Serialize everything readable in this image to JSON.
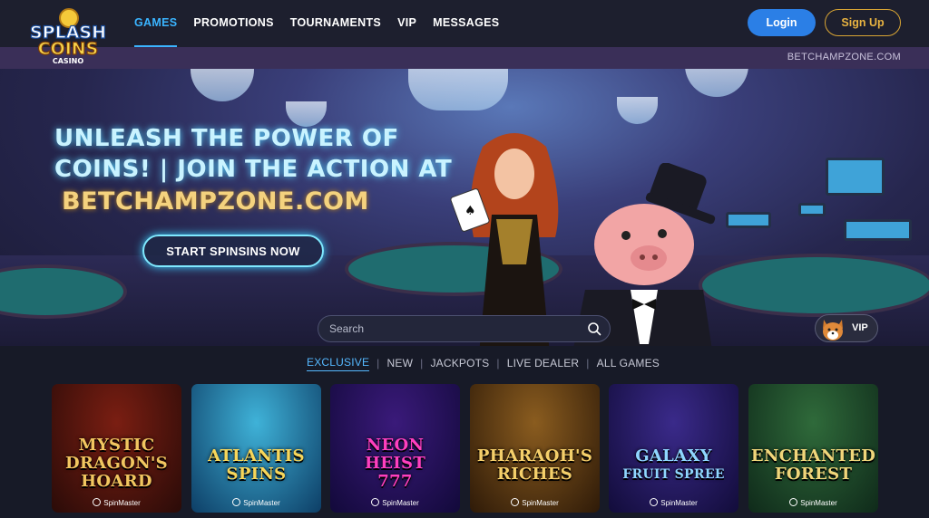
{
  "brand": {
    "logo_line1": "SPLASH",
    "logo_line2": "COINS",
    "logo_line3": "CASINO"
  },
  "nav": {
    "items": [
      "GAMES",
      "PROMOTIONS",
      "TOURNAMENTS",
      "VIP",
      "MESSAGES"
    ],
    "active": "GAMES"
  },
  "auth": {
    "login": "Login",
    "signup": "Sign Up"
  },
  "subbar": {
    "domain": "BETCHAMPZONE.COM"
  },
  "hero": {
    "line1": "UNLEASH THE POWER OF",
    "line2": "COINS! | JOIN THE ACTION AT",
    "line3": "BETCHAMPZONE.COM",
    "cta": "START SPINSINS NOW"
  },
  "search": {
    "placeholder": "Search"
  },
  "vip": {
    "label": "VIP"
  },
  "tabs": {
    "items": [
      "EXCLUSIVE",
      "NEW",
      "JACKPOTS",
      "LIVE DEALER",
      "ALL GAMES"
    ],
    "active": "EXCLUSIVE"
  },
  "games": [
    {
      "title_l1": "MYSTIC",
      "title_l2": "DRAGON'S",
      "title_l3": "HOARD",
      "provider": "SpinMaster",
      "bg1": "#7a1e12",
      "bg2": "#2a0b08",
      "text": "#f2c660"
    },
    {
      "title_l1": "",
      "title_l2": "ATLANTIS",
      "title_l3": "SPINS",
      "provider": "SpinMaster",
      "bg1": "#3fb2d8",
      "bg2": "#0d3e66",
      "text": "#f7d65a"
    },
    {
      "title_l1": "NEON",
      "title_l2": "HEIST",
      "title_l3": "777",
      "provider": "SpinMaster",
      "bg1": "#3a1a7a",
      "bg2": "#12093a",
      "text": "#ff3fbf"
    },
    {
      "title_l1": "",
      "title_l2": "PHARAOH'S",
      "title_l3": "RICHES",
      "provider": "SpinMaster",
      "bg1": "#8a5c1f",
      "bg2": "#2e1a08",
      "text": "#f5cf6a"
    },
    {
      "title_l1": "",
      "title_l2": "GALAXY",
      "title_l3": "FRUIT SPREE",
      "provider": "SpinMaster",
      "bg1": "#3a2a8a",
      "bg2": "#120c3a",
      "text": "#8fd6ff"
    },
    {
      "title_l1": "",
      "title_l2": "ENCHANTED",
      "title_l3": "FOREST",
      "provider": "SpinMaster",
      "bg1": "#2f6a3a",
      "bg2": "#0f2a1a",
      "text": "#f0d67a"
    }
  ]
}
